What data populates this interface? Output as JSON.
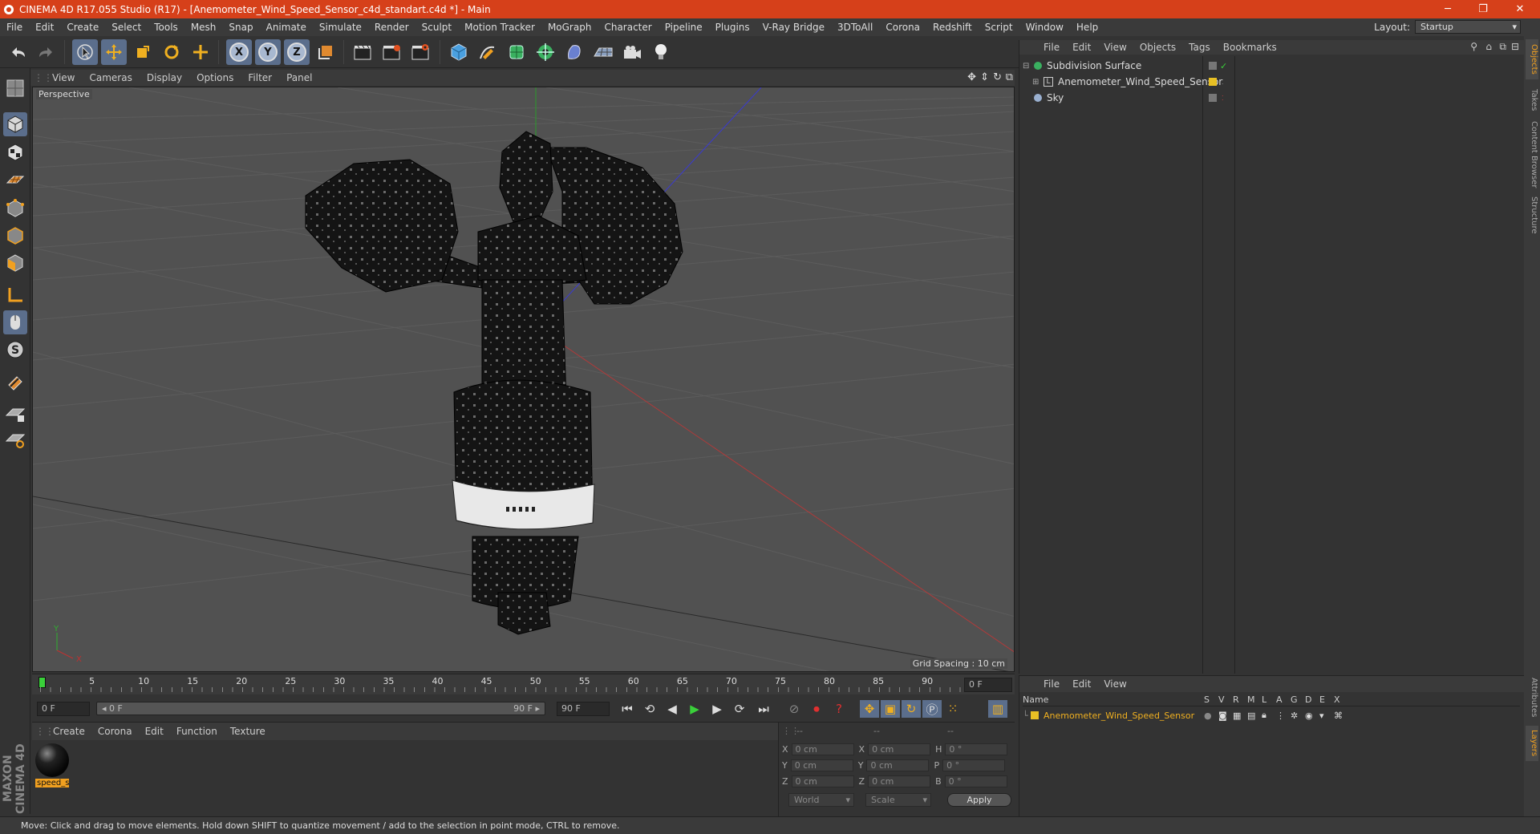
{
  "window": {
    "title": "CINEMA 4D R17.055 Studio (R17) - [Anemometer_Wind_Speed_Sensor_c4d_standart.c4d *] - Main",
    "controls": {
      "minimize": "─",
      "restore": "❐",
      "close": "✕"
    }
  },
  "menubar": {
    "items": [
      "File",
      "Edit",
      "Create",
      "Select",
      "Tools",
      "Mesh",
      "Snap",
      "Animate",
      "Simulate",
      "Render",
      "Sculpt",
      "Motion Tracker",
      "MoGraph",
      "Character",
      "Pipeline",
      "Plugins",
      "V-Ray Bridge",
      "3DToAll",
      "Corona",
      "Redshift",
      "Script",
      "Window",
      "Help"
    ],
    "layout_label": "Layout:",
    "layout_value": "Startup"
  },
  "main_toolbar": {
    "axis_x": "X",
    "axis_y": "Y",
    "axis_z": "Z"
  },
  "viewport": {
    "menu": [
      "View",
      "Cameras",
      "Display",
      "Options",
      "Filter",
      "Panel"
    ],
    "label": "Perspective",
    "grid_spacing": "Grid Spacing : 10 cm",
    "axis_x": "X",
    "axis_y": "Y"
  },
  "timeline": {
    "ticks": [
      "0",
      "5",
      "10",
      "15",
      "20",
      "25",
      "30",
      "35",
      "40",
      "45",
      "50",
      "55",
      "60",
      "65",
      "70",
      "75",
      "80",
      "85",
      "90"
    ],
    "current_frame": "0 F",
    "start_field": "0 F",
    "range_start": "◂ 0 F",
    "range_end": "90 F ▸",
    "end_field": "90 F",
    "playhead_frame": 0
  },
  "material_panel": {
    "menu": [
      "Create",
      "Corona",
      "Edit",
      "Function",
      "Texture"
    ],
    "material_name": "speed_s"
  },
  "coordinates": {
    "header": [
      "--",
      "--",
      "--"
    ],
    "rows": [
      {
        "a_label": "X",
        "a_value": "0 cm",
        "b_label": "X",
        "b_value": "0 cm",
        "c_label": "H",
        "c_value": "0 °"
      },
      {
        "a_label": "Y",
        "a_value": "0 cm",
        "b_label": "Y",
        "b_value": "0 cm",
        "c_label": "P",
        "c_value": "0 °"
      },
      {
        "a_label": "Z",
        "a_value": "0 cm",
        "b_label": "Z",
        "b_value": "0 cm",
        "c_label": "B",
        "c_value": "0 °"
      }
    ],
    "space": "World",
    "mode": "Scale",
    "apply": "Apply"
  },
  "object_manager": {
    "menu": [
      "File",
      "Edit",
      "View",
      "Objects",
      "Tags",
      "Bookmarks"
    ],
    "objects": [
      {
        "name": "Subdivision Surface"
      },
      {
        "name": "Anemometer_Wind_Speed_Sensor"
      },
      {
        "name": "Sky"
      }
    ]
  },
  "layer_manager": {
    "menu": [
      "File",
      "Edit",
      "View"
    ],
    "name_header": "Name",
    "columns": [
      "S",
      "V",
      "R",
      "M",
      "L",
      "A",
      "G",
      "D",
      "E",
      "X"
    ],
    "layers": [
      {
        "name": "Anemometer_Wind_Speed_Sensor",
        "color": "#e8c024"
      }
    ]
  },
  "right_tabs": [
    "Objects",
    "Takes",
    "Content Browser",
    "Structure",
    "Attributes",
    "Layers"
  ],
  "status_bar": "Move: Click and drag to move elements. Hold down SHIFT to quantize movement / add to the selection in point mode, CTRL to remove.",
  "branding": "MAXON CINEMA 4D",
  "colors": {
    "titlebar": "#d6401a",
    "active_tool": "#5b6e8c",
    "selection": "#e8c024",
    "highlight": "#ffaa00"
  }
}
